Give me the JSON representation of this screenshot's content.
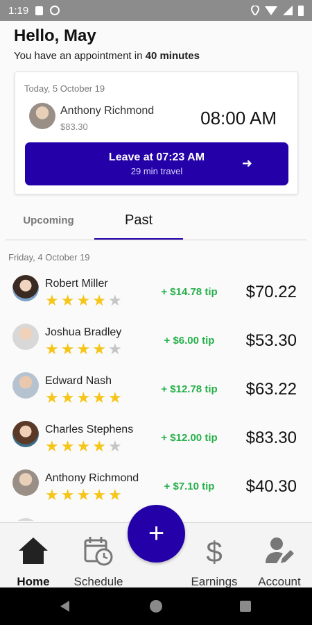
{
  "status_bar": {
    "time": "1:19"
  },
  "header": {
    "greeting": "Hello, May",
    "appointment_prefix": "You have an appointment in ",
    "appointment_eta": "40 minutes"
  },
  "next_appointment": {
    "date": "Today, 5 October 19",
    "client_name": "Anthony Richmond",
    "price": "$83.30",
    "time": "08:00 AM",
    "leave_label": "Leave at 07:23 AM",
    "travel_label": "29 min travel",
    "arrow": "➜"
  },
  "tabs": [
    {
      "label": "Upcoming",
      "active": false
    },
    {
      "label": "Past",
      "active": true
    }
  ],
  "day_label": "Friday, 4 October 19",
  "appointments": [
    {
      "name": "Robert Miller",
      "rating": 4,
      "tip": "+ $14.78 tip",
      "amount": "$70.22"
    },
    {
      "name": "Joshua Bradley",
      "rating": 4,
      "tip": "+ $6.00 tip",
      "amount": "$53.30"
    },
    {
      "name": "Edward Nash",
      "rating": 5,
      "tip": "+ $12.78 tip",
      "amount": "$63.22"
    },
    {
      "name": "Charles Stephens",
      "rating": 4,
      "tip": "+ $12.00 tip",
      "amount": "$83.30"
    },
    {
      "name": "Anthony Richmond",
      "rating": 5,
      "tip": "+ $7.10 tip",
      "amount": "$40.30"
    }
  ],
  "fab": {
    "icon": "plus-icon",
    "label": "+"
  },
  "bottom_nav": [
    {
      "label": "Home",
      "icon": "home-icon",
      "active": true
    },
    {
      "label": "Schedule",
      "icon": "calendar-clock-icon",
      "active": false
    },
    {
      "label": "Earnings",
      "icon": "dollar-icon",
      "active": false
    },
    {
      "label": "Account",
      "icon": "user-edit-icon",
      "active": false
    }
  ],
  "colors": {
    "primary": "#2400a8",
    "tip_green": "#26b04a",
    "star_on": "#f5c518",
    "star_off": "#c6c6c6"
  }
}
